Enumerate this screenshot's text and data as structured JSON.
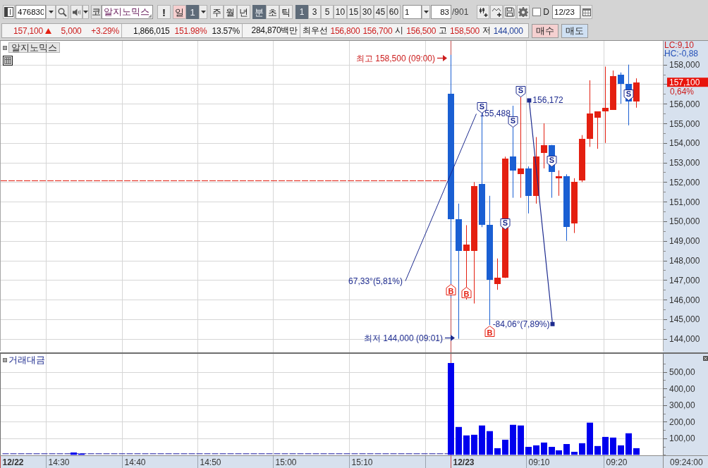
{
  "toolbar": {
    "code_field": {
      "value": "476830"
    },
    "market_label": "코",
    "name_field": {
      "value": "알지노믹스"
    },
    "alert_button": "!",
    "day_selector": {
      "label": "일",
      "value": "1"
    },
    "period_tabs": [
      {
        "label": "주",
        "selected": false
      },
      {
        "label": "월",
        "selected": false
      },
      {
        "label": "년",
        "selected": false
      }
    ],
    "unit_tabs": [
      {
        "label": "분",
        "selected": true
      },
      {
        "label": "초",
        "selected": false
      },
      {
        "label": "틱",
        "selected": false
      }
    ],
    "interval_tabs": [
      {
        "label": "1",
        "selected": true
      },
      {
        "label": "3",
        "selected": false
      },
      {
        "label": "5",
        "selected": false
      },
      {
        "label": "10",
        "selected": false
      },
      {
        "label": "15",
        "selected": false
      },
      {
        "label": "30",
        "selected": false
      },
      {
        "label": "45",
        "selected": false
      },
      {
        "label": "60",
        "selected": false
      }
    ],
    "interval_field": {
      "value": "1"
    },
    "count_field": {
      "value": "83"
    },
    "count_total": "/901",
    "tool_buttons": [
      {
        "kind": "add_candle"
      },
      {
        "kind": "add_line"
      },
      {
        "kind": "save"
      },
      {
        "kind": "settings"
      }
    ],
    "d_option": {
      "label": "D",
      "checked": false
    },
    "date_field": {
      "value": "12/23"
    }
  },
  "quote_bar": {
    "groups": [
      {
        "items": [
          {
            "kind": "value",
            "text": "157,100",
            "color": "#cc1d1d"
          },
          {
            "kind": "up_arrow"
          },
          {
            "kind": "value",
            "text": "5,000",
            "color": "#cc1d1d"
          },
          {
            "kind": "value",
            "text": "+3.29%",
            "color": "#cc1d1d"
          }
        ]
      },
      {
        "items": [
          {
            "kind": "value",
            "text": "1,866,015",
            "color": "#111111"
          },
          {
            "kind": "value",
            "text": "151.98%",
            "color": "#cc1d1d"
          },
          {
            "kind": "value",
            "text": "13.57%",
            "color": "#111111"
          }
        ]
      },
      {
        "items": [
          {
            "kind": "value",
            "text": "284,870백만",
            "color": "#111111"
          }
        ]
      },
      {
        "items": [
          {
            "kind": "label",
            "text": "최우선"
          },
          {
            "kind": "value",
            "text": "156,800",
            "color": "#cc1d1d"
          },
          {
            "kind": "value",
            "text": "156,700",
            "color": "#cc1d1d"
          },
          {
            "kind": "label",
            "text": "시"
          },
          {
            "kind": "value",
            "text": "156,500",
            "color": "#cc1d1d"
          },
          {
            "kind": "label",
            "text": "고"
          },
          {
            "kind": "value",
            "text": "158,500",
            "color": "#cc1d1d"
          },
          {
            "kind": "label",
            "text": "저"
          },
          {
            "kind": "value",
            "text": "144,000",
            "color": "#1f3f9a"
          }
        ]
      }
    ]
  },
  "order_buttons": [
    {
      "label": "매수",
      "kind": "buy"
    },
    {
      "label": "매도",
      "kind": "sell"
    }
  ],
  "price_chart": {
    "legend": "알지노믹스",
    "indicators": [
      {
        "text": "LC:9,10",
        "color": "#cc1d1d"
      },
      {
        "text": "HC:-0,88",
        "color": "#2350b8"
      }
    ],
    "axis_labels": [
      "158,000",
      "156,000",
      "155,000",
      "154,000",
      "153,000",
      "152,000",
      "151,000",
      "150,000",
      "149,000",
      "148,000",
      "147,000",
      "146,000",
      "145,000",
      "144,000"
    ],
    "last_price": {
      "label": "157,100",
      "note": "0,64%"
    },
    "extremes": [
      {
        "kind": "high",
        "text": "최고 158,500 (09:00)"
      },
      {
        "kind": "low",
        "text": "최저 144,000 (09:01)"
      }
    ],
    "trendlines": [
      {
        "selected": false,
        "start_label": "67,33°(5,81%)",
        "end_label": "155,488"
      },
      {
        "selected": true,
        "start_label": "156,172",
        "end_label": "-84,06°(7,89%)"
      }
    ],
    "signals": [
      {
        "kind": "sell",
        "text": "S"
      },
      {
        "kind": "sell",
        "text": "S"
      },
      {
        "kind": "sell",
        "text": "S"
      },
      {
        "kind": "sell",
        "text": "S"
      },
      {
        "kind": "sell",
        "text": "S"
      },
      {
        "kind": "sell",
        "text": "S"
      },
      {
        "kind": "buy",
        "text": "B"
      },
      {
        "kind": "buy",
        "text": "B"
      },
      {
        "kind": "buy",
        "text": "B"
      }
    ]
  },
  "volume_chart": {
    "legend": "거래대금",
    "time_axis": [
      {
        "text": "12/22",
        "kind": "date"
      },
      {
        "text": "14:30",
        "kind": "time"
      },
      {
        "text": "14:40",
        "kind": "time"
      },
      {
        "text": "14:50",
        "kind": "time"
      },
      {
        "text": "15:00",
        "kind": "time"
      },
      {
        "text": "15:10",
        "kind": "time"
      },
      {
        "text": "12/23",
        "kind": "date"
      },
      {
        "text": "09:10",
        "kind": "time"
      },
      {
        "text": "09:20",
        "kind": "time"
      }
    ],
    "time_readout": "09:24:00",
    "chart_data": {
      "type": "bar",
      "categories": [
        null,
        null,
        null,
        null,
        null,
        null,
        null,
        null,
        null,
        null,
        null,
        null,
        null,
        null,
        null,
        null,
        null,
        null,
        null,
        null,
        null,
        null,
        null,
        null,
        null,
        null,
        null,
        null,
        null,
        null,
        null,
        null,
        null,
        null,
        null,
        null,
        null,
        null,
        null,
        null,
        null,
        null,
        null,
        null,
        null,
        null,
        null,
        null,
        null,
        null,
        null,
        null,
        null,
        null,
        null,
        null,
        null,
        null,
        null,
        null,
        null,
        null,
        null,
        null,
        null,
        null,
        null,
        null,
        null,
        null,
        null,
        null,
        null,
        null,
        null,
        null,
        null,
        null,
        null,
        null,
        null,
        null,
        null,
        null,
        null,
        null
      ],
      "values": [
        0,
        0,
        0,
        0,
        0,
        0,
        0,
        0,
        0,
        14,
        7,
        0,
        0,
        0,
        0,
        0,
        0,
        0,
        0,
        0,
        0,
        0,
        0,
        0,
        0,
        0,
        0,
        0,
        0,
        0,
        0,
        0,
        0,
        0,
        0,
        0,
        0,
        0,
        0,
        0,
        0,
        0,
        0,
        0,
        0,
        0,
        0,
        0,
        0,
        0,
        0,
        0,
        0,
        0,
        0,
        0,
        0,
        0,
        554,
        168,
        117,
        121,
        177,
        143,
        40,
        91,
        181,
        177,
        48,
        57,
        74,
        48,
        27,
        65,
        18,
        70,
        194,
        53,
        108,
        104,
        57,
        130,
        40,
        null,
        null,
        null
      ],
      "ylim": [
        -3,
        618
      ],
      "yticks": [
        {
          "value": 100,
          "label": "100,00"
        },
        {
          "value": 200,
          "label": "200,00"
        },
        {
          "value": 300,
          "label": "300,00"
        },
        {
          "value": 400,
          "label": "400,00"
        },
        {
          "value": 500,
          "label": "500,00"
        }
      ],
      "grid": true
    }
  }
}
